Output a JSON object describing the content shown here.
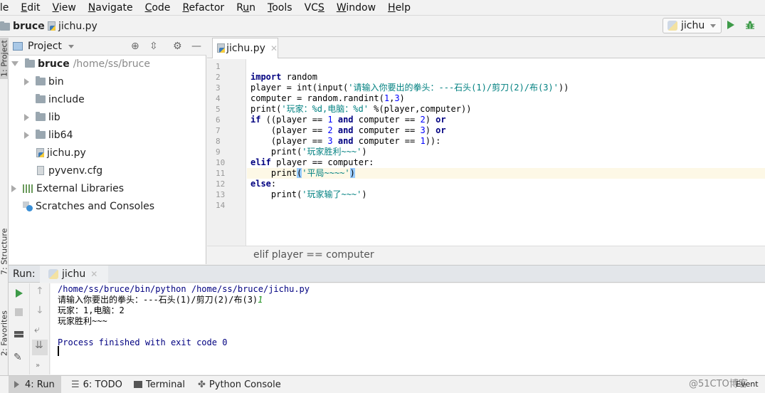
{
  "menubar": {
    "items": [
      {
        "label": "ile",
        "mnemonic": ""
      },
      {
        "label": "Edit",
        "mnemonic": "E"
      },
      {
        "label": "View",
        "mnemonic": "V"
      },
      {
        "label": "Navigate",
        "mnemonic": "N"
      },
      {
        "label": "Code",
        "mnemonic": "C"
      },
      {
        "label": "Refactor",
        "mnemonic": "R"
      },
      {
        "label": "Run",
        "mnemonic": "u"
      },
      {
        "label": "Tools",
        "mnemonic": "T"
      },
      {
        "label": "VCS",
        "mnemonic": "S"
      },
      {
        "label": "Window",
        "mnemonic": "W"
      },
      {
        "label": "Help",
        "mnemonic": "H"
      }
    ]
  },
  "navbar": {
    "project": "bruce",
    "file": "jichu.py",
    "run_config": "jichu",
    "icons": [
      "folder-icon",
      "python-file-icon",
      "run-icon",
      "debug-icon"
    ]
  },
  "side_tabs": {
    "project": "1: Project",
    "structure": "7: Structure",
    "favorites": "2: Favorites"
  },
  "project_panel": {
    "title": "Project",
    "icons": [
      "locate-icon",
      "collapse-icon",
      "gear-icon",
      "minimize-icon"
    ],
    "tree": [
      {
        "label": "bruce",
        "path": "/home/ss/bruce",
        "type": "root-folder",
        "expanded": true
      },
      {
        "label": "bin",
        "type": "folder",
        "expandable": true
      },
      {
        "label": "include",
        "type": "folder",
        "expandable": false
      },
      {
        "label": "lib",
        "type": "folder",
        "expandable": true
      },
      {
        "label": "lib64",
        "type": "symlink-folder",
        "expandable": true
      },
      {
        "label": "jichu.py",
        "type": "python-file"
      },
      {
        "label": "pyvenv.cfg",
        "type": "config-file"
      },
      {
        "label": "External Libraries",
        "type": "libraries",
        "expandable": true
      },
      {
        "label": "Scratches and Consoles",
        "type": "scratches"
      }
    ]
  },
  "editor": {
    "tab": "jichu.py",
    "current_line": 11,
    "line_numbers": [
      "1",
      "2",
      "3",
      "4",
      "5",
      "6",
      "7",
      "8",
      "9",
      "10",
      "11",
      "12",
      "13",
      "14"
    ],
    "lines": [
      "",
      "import random",
      "player = int(input('请输入你要出的拳头：---石头(1)/剪刀(2)/布(3)'))",
      "computer = random.randint(1,3)",
      "print('玩家：%d,电脑：%d' %(player,computer))",
      "if ((player == 1 and computer == 2) or",
      "    (player == 2 and computer == 3) or",
      "    (player == 3 and computer == 1)):",
      "    print('玩家胜利~~~')",
      "elif player == computer:",
      "    print('平局~~~~')",
      "else:",
      "    print('玩家输了~~~')",
      ""
    ],
    "breadcrumb": "elif player == computer"
  },
  "run_panel": {
    "label": "Run:",
    "tab": "jichu",
    "console": [
      {
        "text": "/home/ss/bruce/bin/python /home/ss/bruce/jichu.py",
        "style": "blue"
      },
      {
        "text": "请输入你要出的拳头：---石头(1)/剪刀(2)/布(3)",
        "input": "1",
        "style": "normal"
      },
      {
        "text": "玩家：1,电脑：2",
        "style": "normal"
      },
      {
        "text": "玩家胜利~~~",
        "style": "normal"
      },
      {
        "text": "",
        "style": "normal"
      },
      {
        "text": "Process finished with exit code 0",
        "style": "blue"
      }
    ]
  },
  "bottom_bar": {
    "tabs": [
      {
        "label": "4: Run",
        "mnemonic": "4",
        "active": true
      },
      {
        "label": "6: TODO",
        "mnemonic": "6",
        "active": false
      },
      {
        "label": "Terminal",
        "active": false
      },
      {
        "label": "Python Console",
        "active": false
      }
    ],
    "watermark": "@51CTO博客",
    "event_log": "Event"
  },
  "colors": {
    "keyword": "#000080",
    "string": "#008080",
    "number": "#0000ff",
    "run_green": "#3d9a48",
    "current_line": "#fdf8e6"
  }
}
